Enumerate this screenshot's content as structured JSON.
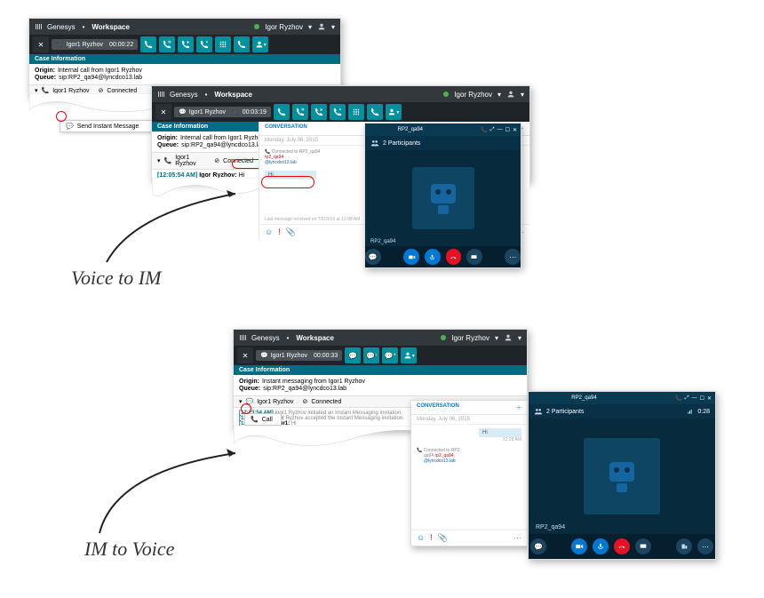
{
  "brand": {
    "product": "Genesys",
    "suite": "Workspace"
  },
  "user": {
    "name": "Igor Ryzhov"
  },
  "scene1": {
    "toolbar_name": "Igor1 Ryzhov",
    "timer": "00:00:22",
    "case_title": "Case Information",
    "origin_label": "Origin:",
    "origin_value": "Internal call from Igor1 Ryzhov",
    "queue_label": "Queue:",
    "queue_value": "sip:RP2_qa94@lyncdco13.lab",
    "party": "Igor1 Ryzhov",
    "status_icon": "⊘",
    "status": "Connected",
    "menu_item": "Send Instant Message"
  },
  "scene2": {
    "toolbar_name": "Igor1 Ryzhov",
    "timer": "00:03:19",
    "case_title": "Case Information",
    "origin_label": "Origin:",
    "origin_value": "Internal call from Igor1 Ryzhov",
    "queue_label": "Queue:",
    "queue_value": "sip:RP2_qa94@lyncdco13.lab",
    "party": "Igor1 Ryzhov",
    "status_icon": "⊘",
    "status": "Connected",
    "log_ts": "[12:05:54 AM]",
    "log_who": "Igor Ryzhov:",
    "log_msg": "Hi",
    "conv_tab": "CONVERSATION",
    "conv_date": "Monday, July 06, 2015",
    "conv_connected": "Connected to RP2_qa94",
    "conv_link1": "rp2_qa94",
    "conv_link2": "@lyncdco13.lab",
    "conv_msg": "Hi",
    "conv_footer": "Last message received on 7/6/2015 at 12:08 AM",
    "skype_title": "RP2_qa94",
    "participants": "2 Participants",
    "skype_name_label": "RP2_qa94"
  },
  "scene3": {
    "toolbar_name": "Igor1 Ryzhov",
    "timer": "00:00:33",
    "case_title": "Case Information",
    "origin_label": "Origin:",
    "origin_value": "Instant messaging from Igor1 Ryzhov",
    "queue_label": "Queue:",
    "queue_value": "sip:RP2_qa94@lyncdco13.lab",
    "party": "Igor1 Ryzhov",
    "status_icon": "⊘",
    "status": "Connected",
    "menu_item": "Call",
    "log_ts1": "[12:23:54 AM]",
    "log_msg1": "Igor1 Ryzhov initiated an Instant Messaging invitation.",
    "log_ts2": "[12:23:54 AM]",
    "log_msg2": "Igor Ryzhov accepted the Instant Messaging invitation.",
    "log_ts3": "[12:23:56 AM]",
    "log_who3": "Igor1:",
    "log_msg3": "Hi",
    "conv_tab": "CONVERSATION",
    "conv_date": "Monday, July 06, 2015",
    "conv_msg": "Hi",
    "conv_time": "12:28 AM",
    "conv_connected": "Connected to RP2",
    "conv_link1": "rp2_qa94",
    "conv_link2": "@lyncdco13.lab",
    "skype_title": "RP2_qa94",
    "participants": "2 Participants",
    "skype_time": "0:28",
    "skype_name_label": "RP2_qa94"
  },
  "labels": {
    "voice_to_im": "Voice to IM",
    "im_to_voice": "IM to Voice"
  }
}
